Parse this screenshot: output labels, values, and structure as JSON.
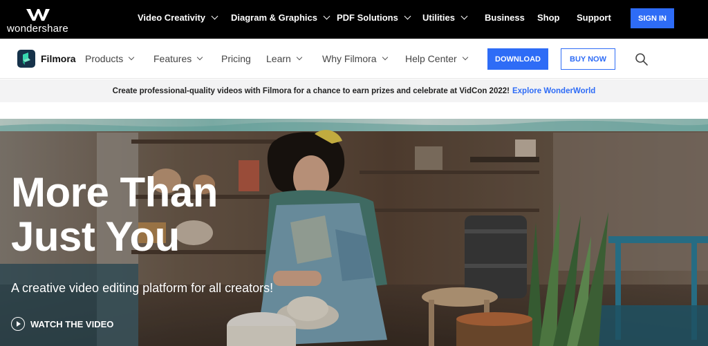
{
  "brand": {
    "name": "wondershare"
  },
  "topnav": {
    "items": [
      {
        "label": "Video Creativity",
        "dropdown": true
      },
      {
        "label": "Diagram & Graphics",
        "dropdown": true
      },
      {
        "label": "PDF Solutions",
        "dropdown": true
      },
      {
        "label": "Utilities",
        "dropdown": true
      },
      {
        "label": "Business",
        "dropdown": false
      },
      {
        "label": "Shop",
        "dropdown": false
      },
      {
        "label": "Support",
        "dropdown": false
      }
    ],
    "signin_label": "SIGN IN"
  },
  "product_nav": {
    "name": "Filmora",
    "items": [
      {
        "label": "Products",
        "dropdown": true
      },
      {
        "label": "Features",
        "dropdown": true
      },
      {
        "label": "Pricing",
        "dropdown": false
      },
      {
        "label": "Learn",
        "dropdown": true
      },
      {
        "label": "Why Filmora",
        "dropdown": true
      },
      {
        "label": "Help Center",
        "dropdown": true
      }
    ],
    "download_label": "DOWNLOAD",
    "buynow_label": "BUY NOW"
  },
  "announcement": {
    "text": "Create professional-quality videos with Filmora for a chance to earn prizes and celebrate at VidCon 2022!",
    "link": "Explore WonderWorld"
  },
  "hero": {
    "title_line1": "More Than",
    "title_line2": "Just You",
    "subtitle": "A creative video editing platform for all creators!",
    "watch_label": "WATCH THE VIDEO"
  },
  "colors": {
    "accent": "#2e6cf6",
    "topbar": "#000000",
    "announce_bg": "#f3f3f4"
  },
  "icons": [
    "wondershare-logo-icon",
    "filmora-logo-icon",
    "search-icon",
    "play-icon",
    "chevron-down-icon"
  ]
}
